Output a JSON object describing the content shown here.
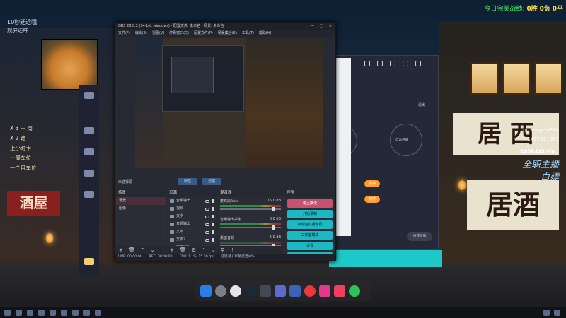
{
  "overlay": {
    "record_label": "今日完美战绩:",
    "wins": "0胜",
    "draws": "0负",
    "losses": "0平",
    "delay_line1": "10秒延迟哦",
    "delay_line2": "观屏达咩",
    "gifts": [
      "X 3 — 周",
      "X 2 谁",
      "上小时卡",
      "一周车位",
      "一个月车位"
    ],
    "qq_line1": "qq:tongzhi314",
    "qq_line2": "1457311987",
    "ts": "ts:bt.ts3.vip",
    "big1": "全职主播",
    "big2": "白嫖"
  },
  "obs": {
    "title": "OBS 28.0.2 (64-bit, windows) - 配置文件: 未命名 - 场景: 未命名",
    "menu": [
      "文件(F)",
      "编辑(E)",
      "视图(V)",
      "停靠窗口(D)",
      "配置文件(P)",
      "场景集合(S)",
      "工具(T)",
      "帮助(H)"
    ],
    "scene_bar": {
      "label": "未选择源",
      "btn1": "属性",
      "btn2": "滤镜"
    },
    "scenes": {
      "header": "场景",
      "items": [
        "场景",
        "图像"
      ]
    },
    "sources": {
      "header": "来源",
      "items": [
        "音频输出",
        "视频",
        "文字",
        "音频输出",
        "文本",
        "文本2",
        "文本图片"
      ]
    },
    "mixer": {
      "header": "混音器",
      "tracks": [
        {
          "name": "麦克风/Aux",
          "db": "15.0 dB"
        },
        {
          "name": "音频输出采集",
          "db": "0.0 dB"
        },
        {
          "name": "桌面音频",
          "db": "-5.0 dB"
        }
      ]
    },
    "controls": {
      "header": "控件",
      "buttons": [
        "停止推流",
        "开始录制",
        "启动虚拟摄像机",
        "工作室模式",
        "设置",
        "退出"
      ]
    },
    "status": [
      "LIVE: 00:00:00",
      "REC: 00:00:00",
      "CPU: 1.1%, 15.00 fps",
      "延迟(丢) 10秒延迟(0%)"
    ]
  },
  "right_app": {
    "label_auto": "自动开播",
    "title_right": "退出",
    "pills": [
      "暂停",
      "暂停"
    ],
    "bottom_btn": "推荐直播"
  },
  "colors": {
    "accent": "#1cb8c4",
    "stop": "#c9506f",
    "win": "#4ef06a",
    "score": "#ffe04a"
  }
}
